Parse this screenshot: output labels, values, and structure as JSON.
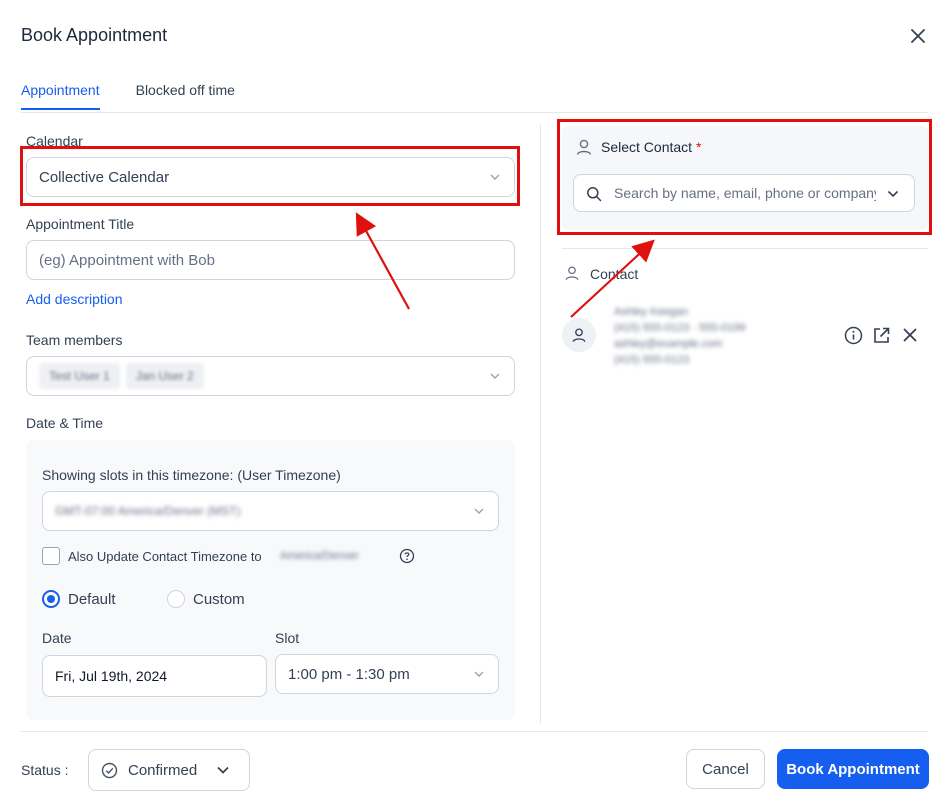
{
  "dialog": {
    "title": "Book Appointment"
  },
  "tabs": [
    {
      "label": "Appointment",
      "active": true
    },
    {
      "label": "Blocked off time",
      "active": false
    }
  ],
  "form": {
    "calendar_label": "Calendar",
    "calendar_value": "Collective Calendar",
    "title_label": "Appointment Title",
    "title_placeholder": "(eg) Appointment with Bob",
    "add_description": "Add description",
    "team_label": "Team members",
    "team_members": [
      "Test User 1",
      "Jan User 2"
    ],
    "datetime_label": "Date & Time",
    "timezone_label": "Showing slots in this timezone: (User Timezone)",
    "timezone_value": "GMT-07:00 America/Denver (MST)",
    "update_tz_label": "Also Update Contact Timezone to",
    "update_tz_value": "America/Denver",
    "radio_default": "Default",
    "radio_custom": "Custom",
    "date_label": "Date",
    "date_value": "Fri, Jul 19th, 2024",
    "slot_label": "Slot",
    "slot_value": "1:00 pm - 1:30 pm"
  },
  "contact_panel": {
    "select_label": "Select Contact",
    "required_mark": "*",
    "search_placeholder": "Search by name, email, phone or company",
    "contact_heading": "Contact",
    "contact_name": "Ashley Keegan",
    "contact_phone": "(415) 555-0123 · 555-0199",
    "contact_email": "ashley@example.com",
    "contact_extra": "(415) 555-0123"
  },
  "footer": {
    "status_label": "Status :",
    "status_value": "Confirmed",
    "cancel_label": "Cancel",
    "submit_label": "Book Appointment"
  },
  "colors": {
    "accent": "#155eef",
    "annotation": "#e01010"
  }
}
